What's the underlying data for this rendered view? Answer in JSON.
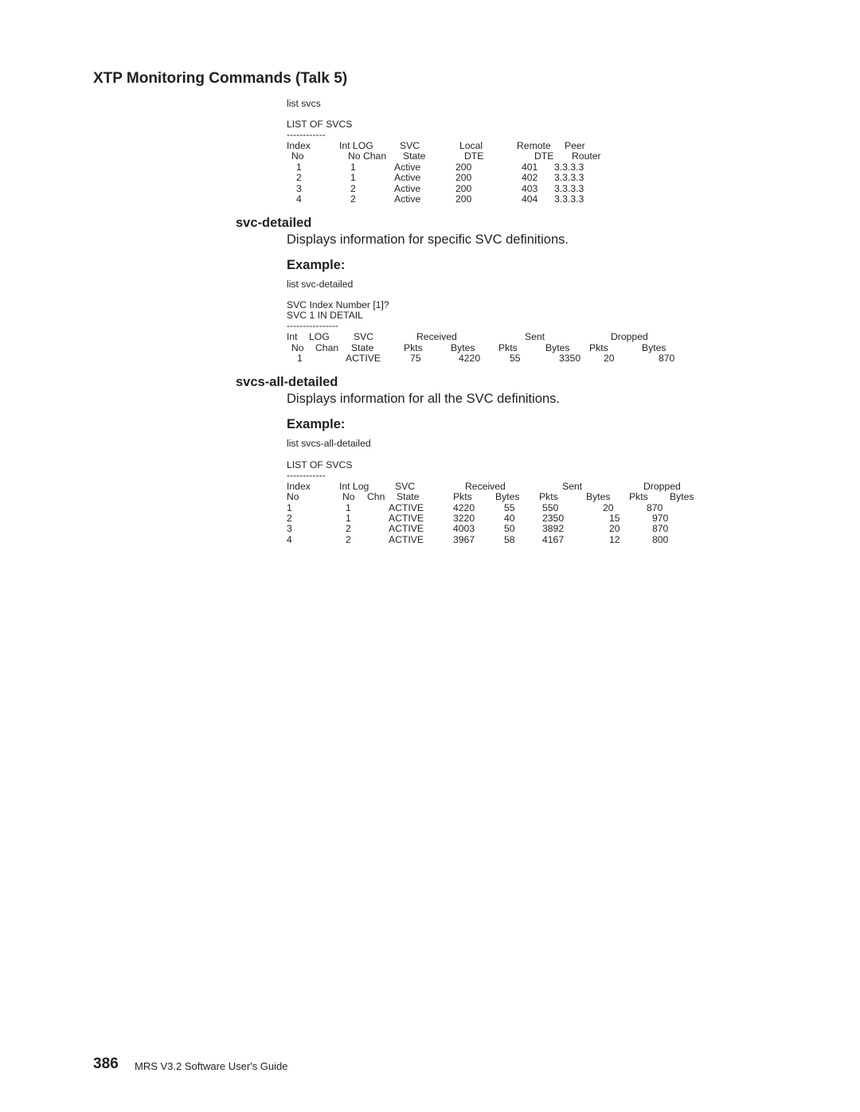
{
  "page": {
    "section_title": "XTP Monitoring Commands (Talk 5)",
    "page_number": "386",
    "book_title": "MRS V3.2 Software User's Guide"
  },
  "list_svcs": {
    "command": "list  svcs",
    "output_title": "LIST  OF  SVCS",
    "separator": "------------",
    "header_row1": [
      "Index",
      "Int  LOG",
      "SVC",
      "Local",
      "Remote",
      "Peer"
    ],
    "header_row2": [
      "No",
      "No  Chan",
      "State",
      "DTE",
      "DTE",
      "Router"
    ],
    "rows": [
      {
        "index": "1",
        "log_chan": "1",
        "state": "Active",
        "local_dte": "200",
        "remote_dte": "401",
        "peer": "3.3.3.3"
      },
      {
        "index": "2",
        "log_chan": "1",
        "state": "Active",
        "local_dte": "200",
        "remote_dte": "402",
        "peer": "3.3.3.3"
      },
      {
        "index": "3",
        "log_chan": "2",
        "state": "Active",
        "local_dte": "200",
        "remote_dte": "403",
        "peer": "3.3.3.3"
      },
      {
        "index": "4",
        "log_chan": "2",
        "state": "Active",
        "local_dte": "200",
        "remote_dte": "404",
        "peer": "3.3.3.3"
      }
    ]
  },
  "svc_detailed": {
    "heading": "svc-detailed",
    "description": "Displays information for specific SVC definitions.",
    "example_label": "Example:",
    "command": "list  svc-detailed",
    "prompt": "SVC  Index  Number  [1]?",
    "output_title": "SVC    1  IN  DETAIL",
    "separator": "----------------",
    "header_row1": [
      "Int",
      "LOG",
      "SVC",
      "Received",
      "Sent",
      "Dropped"
    ],
    "header_row2": [
      "No",
      "Chan",
      "State",
      "Pkts",
      "Bytes",
      "Pkts",
      "Bytes",
      "Pkts",
      "Bytes"
    ],
    "row": {
      "int_no": "1",
      "log_chan": "",
      "state": "ACTIVE",
      "rx_pkts": "75",
      "rx_bytes": "4220",
      "tx_pkts": "55",
      "tx_bytes": "3350",
      "drop_pkts": "20",
      "drop_bytes": "870"
    }
  },
  "svcs_all_detailed": {
    "heading": "svcs-all-detailed",
    "description": "Displays information for all the SVC definitions.",
    "example_label": "Example:",
    "command": "list  svcs-all-detailed",
    "output_title": "LIST  OF  SVCS",
    "separator": "------------",
    "header_row1": [
      "Index",
      "Int  Log",
      "SVC",
      "Received",
      "Sent",
      "Dropped"
    ],
    "header_row2": [
      "No",
      "No",
      "Chn",
      "State",
      "Pkts",
      "Bytes",
      "Pkts",
      "Bytes",
      "Pkts",
      "Bytes"
    ],
    "rows": [
      {
        "index": "1",
        "int_no": "1",
        "state": "ACTIVE",
        "c1": "4220",
        "c2": "55",
        "c3": "550",
        "c4": "20",
        "c5": "870"
      },
      {
        "index": "2",
        "int_no": "1",
        "state": "ACTIVE",
        "c1": "3220",
        "c2": "40",
        "c3": "2350",
        "c4": "15",
        "c5": "970"
      },
      {
        "index": "3",
        "int_no": "2",
        "state": "ACTIVE",
        "c1": "4003",
        "c2": "50",
        "c3": "3892",
        "c4": "20",
        "c5": "870"
      },
      {
        "index": "4",
        "int_no": "2",
        "state": "ACTIVE",
        "c1": "3967",
        "c2": "58",
        "c3": "4167",
        "c4": "12",
        "c5": "800"
      }
    ]
  }
}
